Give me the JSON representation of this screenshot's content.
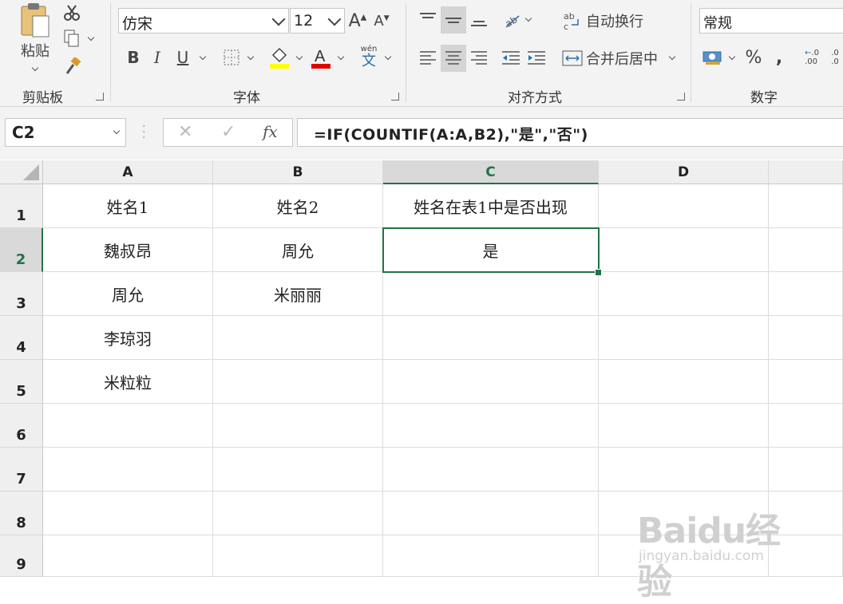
{
  "ribbon": {
    "clipboard": {
      "paste_label": "粘贴",
      "group_label": "剪贴板"
    },
    "font": {
      "family": "仿宋",
      "size": "12",
      "phonetic_label": "wén",
      "phonetic_char": "文",
      "group_label": "字体"
    },
    "alignment": {
      "wrap_label": "自动换行",
      "merge_label": "合并后居中",
      "group_label": "对齐方式"
    },
    "number": {
      "format": "常规",
      "percent": "%",
      "comma": ",",
      "group_label": "数字"
    }
  },
  "formula_bar": {
    "name_box": "C2",
    "fx": "fx",
    "formula": "=IF(COUNTIF(A:A,B2),\"是\",\"否\")"
  },
  "sheet": {
    "columns": [
      "A",
      "B",
      "C",
      "D"
    ],
    "rows": [
      "1",
      "2",
      "3",
      "4",
      "5",
      "6",
      "7",
      "8",
      "9"
    ],
    "cells": {
      "A1": "姓名1",
      "B1": "姓名2",
      "C1": "姓名在表1中是否出现",
      "A2": "魏叔昂",
      "B2": "周允",
      "C2": "是",
      "A3": "周允",
      "B3": "米丽丽",
      "A4": "李琼羽",
      "A5": "米粒粒"
    },
    "active_cell": "C2",
    "accent_color": "#217346"
  },
  "watermark": {
    "brand": "Baidu经验",
    "url": "jingyan.baidu.com"
  }
}
